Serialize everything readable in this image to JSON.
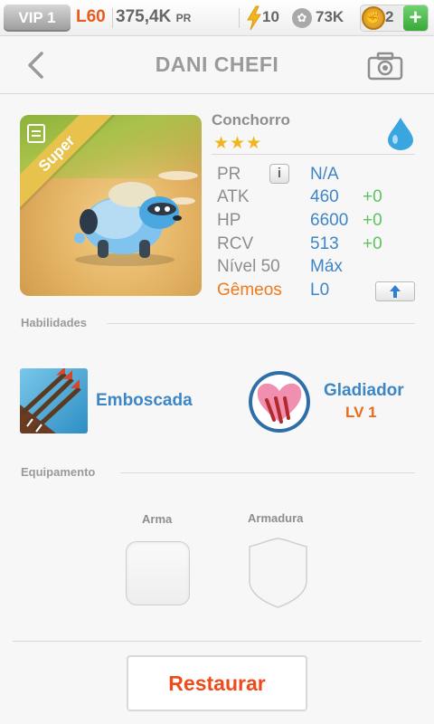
{
  "topbar": {
    "vip_label": "VIP 1",
    "level": "L60",
    "pr_value": "375,4K",
    "pr_unit": "PR",
    "energy_icon": "lightning-icon",
    "energy": "10",
    "paw_icon": "paw-icon",
    "paw_count": "73K",
    "coin_icon": "coin-icon",
    "coins": "2",
    "plus_label": "+"
  },
  "header": {
    "title": "DANI CHEFI",
    "back_icon": "chevron-left-icon",
    "camera_icon": "camera-icon"
  },
  "creature": {
    "name": "Conchorro",
    "stars": "★★★",
    "badge": "Super",
    "zodiac_symbol": "♊",
    "element_icon": "water-drop-icon",
    "stats": {
      "pr_label": "PR",
      "pr_value": "N/A",
      "info_label": "i",
      "atk_label": "ATK",
      "atk_value": "460",
      "atk_bonus": "+0",
      "hp_label": "HP",
      "hp_value": "6600",
      "hp_bonus": "+0",
      "rcv_label": "RCV",
      "rcv_value": "513",
      "rcv_bonus": "+0",
      "level_label": "Nível 50",
      "level_value": "Máx",
      "sign_label": "Gêmeos",
      "sign_value": "L0",
      "upgrade_icon": "arrow-up-icon"
    }
  },
  "skills": {
    "section_label": "Habilidades",
    "active_name": "Emboscada",
    "passive_name": "Gladiador",
    "passive_level": "LV 1"
  },
  "equipment": {
    "section_label": "Equipamento",
    "weapon_label": "Arma",
    "armor_label": "Armadura"
  },
  "footer": {
    "restore_label": "Restaurar"
  },
  "colors": {
    "accent_blue": "#3d86c6",
    "accent_orange": "#ee7a1c",
    "bonus_green": "#5fc25f",
    "star_gold": "#f2b51c",
    "restore_red": "#ee4a1a"
  }
}
